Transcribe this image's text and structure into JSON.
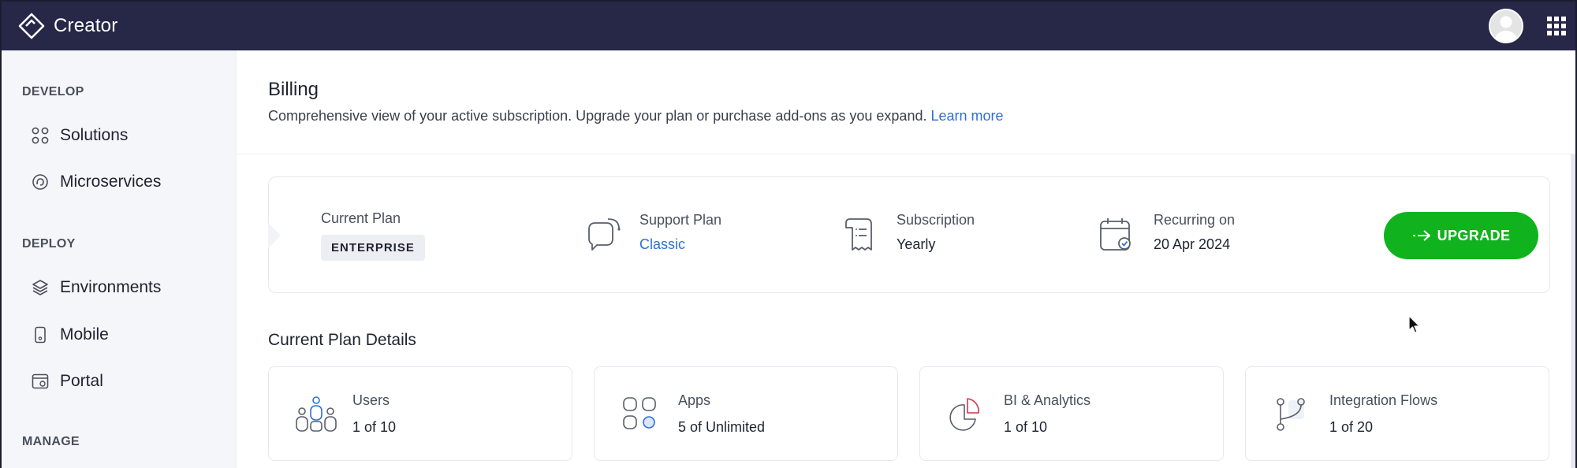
{
  "app": {
    "title": "Creator"
  },
  "sidebar": {
    "sections": [
      {
        "heading": "DEVELOP",
        "items": [
          {
            "label": "Solutions",
            "icon": "grid-circles-icon"
          },
          {
            "label": "Microservices",
            "icon": "microservices-icon"
          }
        ]
      },
      {
        "heading": "DEPLOY",
        "items": [
          {
            "label": "Environments",
            "icon": "layers-icon"
          },
          {
            "label": "Mobile",
            "icon": "mobile-icon"
          },
          {
            "label": "Portal",
            "icon": "portal-icon"
          }
        ]
      },
      {
        "heading": "MANAGE",
        "items": []
      }
    ]
  },
  "billing": {
    "title": "Billing",
    "description": "Comprehensive view of your active subscription. Upgrade your plan or purchase add-ons as you expand.",
    "learn_more": "Learn more"
  },
  "plan": {
    "current_plan_label": "Current Plan",
    "current_plan_value": "ENTERPRISE",
    "support_plan_label": "Support Plan",
    "support_plan_value": "Classic",
    "subscription_label": "Subscription",
    "subscription_value": "Yearly",
    "recurring_label": "Recurring on",
    "recurring_value": "20 Apr 2024",
    "upgrade_label": "UPGRADE"
  },
  "details": {
    "title": "Current Plan Details",
    "cards": [
      {
        "label": "Users",
        "value": "1 of 10",
        "icon": "users-icon"
      },
      {
        "label": "Apps",
        "value": "5 of Unlimited",
        "icon": "apps-icon"
      },
      {
        "label": "BI & Analytics",
        "value": "1 of 10",
        "icon": "pie-chart-icon"
      },
      {
        "label": "Integration Flows",
        "value": "1 of 20",
        "icon": "flow-branch-icon"
      }
    ]
  },
  "colors": {
    "topbar": "#272848",
    "sidebar": "#f5f6fa",
    "accent_link": "#2e6fd8",
    "upgrade_button": "#10b31e"
  }
}
